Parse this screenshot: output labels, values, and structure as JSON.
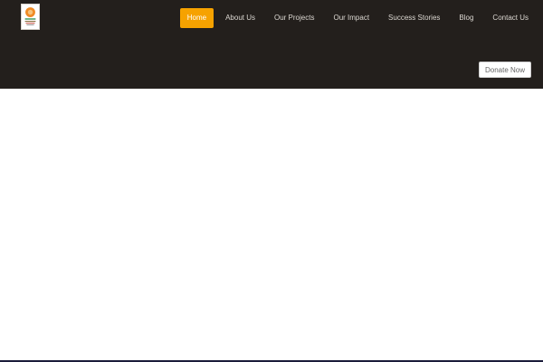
{
  "header": {
    "logo": {
      "icon": "organization-logo-icon",
      "colors": [
        "#f08a24",
        "#2f8f4e",
        "#c0392b"
      ]
    },
    "nav": {
      "items": [
        {
          "label": "Home",
          "active": true
        },
        {
          "label": "About Us",
          "active": false
        },
        {
          "label": "Our Projects",
          "active": false
        },
        {
          "label": "Our Impact",
          "active": false
        },
        {
          "label": "Success Stories",
          "active": false
        },
        {
          "label": "Blog",
          "active": false
        },
        {
          "label": "Contact Us",
          "active": false
        }
      ]
    },
    "donate_label": "Donate Now"
  },
  "colors": {
    "header_bg": "#231f1c",
    "accent": "#f6a200",
    "nav_text": "#dcd8d2",
    "footer_bar": "#1b1c3a"
  }
}
